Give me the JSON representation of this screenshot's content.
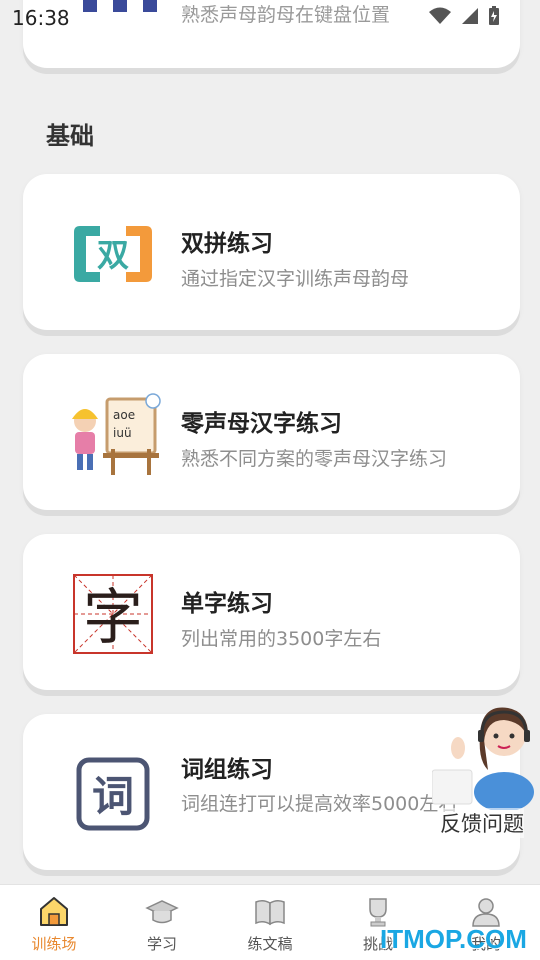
{
  "status": {
    "time": "16:38"
  },
  "top_card": {
    "subtitle": "熟悉声母韵母在键盘位置"
  },
  "section": {
    "title": "基础"
  },
  "items": [
    {
      "title": "双拼练习",
      "desc": "通过指定汉字训练声母韵母",
      "icon": "shuang-icon",
      "icon_text": "双"
    },
    {
      "title": "零声母汉字练习",
      "desc": "熟悉不同方案的零声母汉字练习",
      "icon": "child-easel-icon",
      "icon_text_1": "aoe",
      "icon_text_2": "iuü"
    },
    {
      "title": "单字练习",
      "desc": "列出常用的3500字左右",
      "icon": "zi-grid-icon",
      "icon_text": "字"
    },
    {
      "title": "词组练习",
      "desc": "词组连打可以提高效率5000左右",
      "icon": "ci-icon",
      "icon_text": "词"
    }
  ],
  "feedback": {
    "label": "反馈问题"
  },
  "tabs": [
    {
      "label": "训练场",
      "icon": "home-icon",
      "active": true
    },
    {
      "label": "学习",
      "icon": "graduation-cap-icon",
      "active": false
    },
    {
      "label": "练文稿",
      "icon": "book-icon",
      "active": false
    },
    {
      "label": "挑战",
      "icon": "trophy-icon",
      "active": false
    },
    {
      "label": "我的",
      "icon": "user-icon",
      "active": false
    }
  ],
  "watermark": "ITMOP.COM",
  "colors": {
    "accent": "#e8882f",
    "teal": "#3aa9a3",
    "orange": "#f39a3b",
    "red": "#c8352b",
    "navy": "#4c5573"
  }
}
